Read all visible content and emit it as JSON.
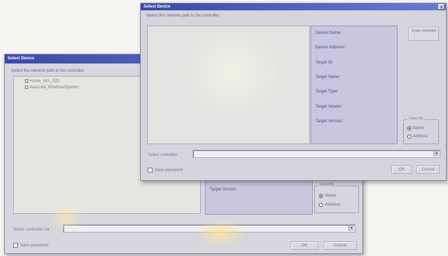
{
  "back_dialog": {
    "title": "Select Device",
    "prompt": "Select the network path to the controller",
    "tree": [
      {
        "label": "Home_IAS_22D"
      },
      {
        "label": "AutoLink_WindowsSystem"
      }
    ],
    "info_labels": [
      "Target Version"
    ],
    "radio_group": {
      "title": "Select By",
      "options": [
        {
          "label": "Name",
          "selected": true
        },
        {
          "label": "Address",
          "selected": false
        }
      ]
    },
    "path_label": "Select controller via",
    "checkbox_label": "Save password",
    "ok_label": "OK",
    "cancel_label": "Cancel"
  },
  "front_dialog": {
    "title": "Select Device",
    "close_glyph": "x",
    "prompt": "Select the network path to the controller",
    "info_labels": [
      "Device Name:",
      "Device Address:",
      "Target ID:",
      "Target Name:",
      "Target Type:",
      "Target Vendor:",
      "Target Version:"
    ],
    "side_button_label": "Scan network",
    "radio_group": {
      "title": "Select By",
      "options": [
        {
          "label": "Name",
          "selected": true
        },
        {
          "label": "Address",
          "selected": false
        }
      ]
    },
    "path_label": "Select controller",
    "checkbox_label": "Save password",
    "ok_label": "OK",
    "cancel_label": "Cancel"
  }
}
